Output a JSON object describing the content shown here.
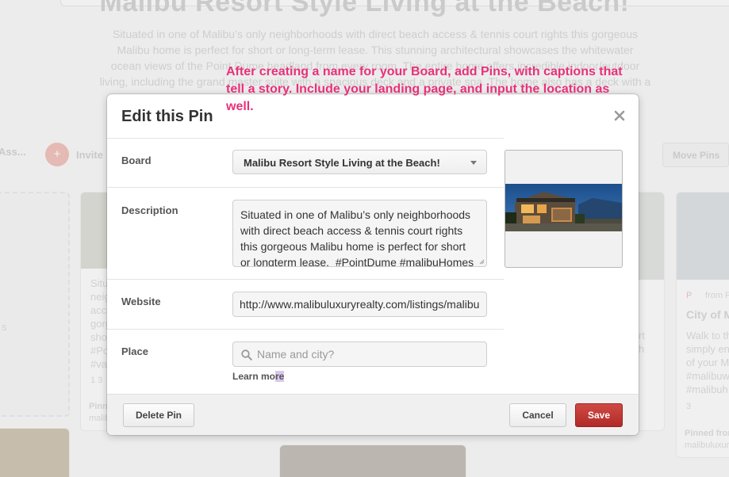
{
  "background": {
    "board_title": "Malibu Resort Style Living at the Beach!",
    "board_description_lines": [
      "Situated in one of Malibu’s only neighborhoods with direct beach access & tennis court rights this gorgeous",
      "Malibu home is perfect for short or long-term lease. This stunning architectural showcases the whitewater",
      "ocean views of the Point Dume headland from every room. The entire home offers incredible indoor/outdoor",
      "living, including the grand master suite with a spacious deck and a private spa. The home also has a deck with a"
    ],
    "assistant_text": "Ass...",
    "invite_label": "Invite",
    "move_pins_label": "Move Pins",
    "card_left_lines": [
      "Situ",
      "neig",
      "acce",
      "gorg",
      "shor",
      "#Po",
      "#va"
    ],
    "card_left_meta": "1 3",
    "card_left_footer": [
      "Pinn",
      "malib"
    ],
    "card_right_source": "from F",
    "card_right_title": "City of M",
    "card_right_lines": [
      "Walk to th",
      "simply en",
      "of your M",
      "#malibuw",
      "#malibuh"
    ],
    "card_right_meta": "3",
    "card_right_footer": [
      "Pinned from",
      "malibuluxury"
    ],
    "card_mid_lines": [
      "rt",
      "h"
    ],
    "far_left_text": "s"
  },
  "callout": {
    "line1": "After creating a name for your Board, add Pins, with captions that",
    "line2": "tell a story. Include your landing page, and input the location as",
    "line3": "well."
  },
  "modal": {
    "title": "Edit this Pin",
    "board": {
      "label": "Board",
      "selected": "Malibu Resort Style Living at the Beach!"
    },
    "description": {
      "label": "Description",
      "lines": [
        "Situated in one of Malibu’s only neighborhoods",
        "with direct beach access & tennis court rights",
        "this gorgeous Malibu home is perfect for short",
        "or longterm lease.  #PointDume #malibuHomes"
      ]
    },
    "website": {
      "label": "Website",
      "value": "http://www.malibuluxuryrealty.com/listings/malibu"
    },
    "place": {
      "label": "Place",
      "placeholder": "Name and city?",
      "learn_more_prefix": "Learn mo",
      "learn_more_highlight": "re"
    },
    "footer": {
      "delete_label": "Delete Pin",
      "cancel_label": "Cancel",
      "save_label": "Save"
    }
  },
  "colors": {
    "callout_pink": "#e8317a",
    "save_red": "#b8302c",
    "overlay_grey": "#e9e9e9"
  },
  "icons": {
    "close": "close-icon",
    "search": "search-icon",
    "dropdown": "chevron-down-icon"
  }
}
